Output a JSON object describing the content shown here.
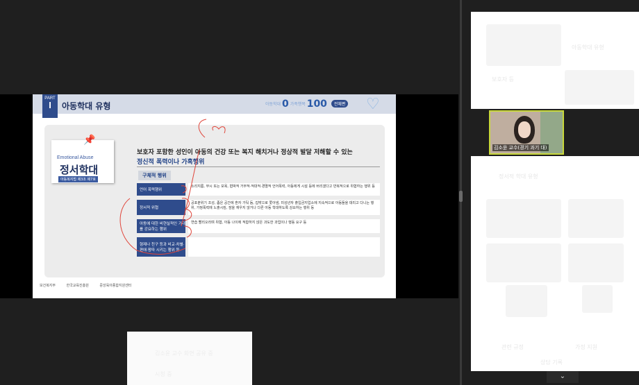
{
  "slide": {
    "part_label": "PART",
    "part_number": "I",
    "title": "아동학대 유형",
    "score_label_left": "아동학대",
    "score_zero": "0",
    "score_label_right": "가족행복",
    "score_hundred": "100",
    "score_pill": "전체편",
    "sticky": {
      "english": "Emotional Abuse",
      "korean": "정서학대",
      "law": "아동복지법 제3조 제7호"
    },
    "definition_line1": "보호자 포함한 성인이 아동의 건강 또는 복지 해치거나 정상적 발달 저해할 수 있는",
    "definition_line2": "정신적 폭력이나 가혹행위",
    "section_heading": "구체적 행위",
    "rows": [
      {
        "label": "언어 폭력행위",
        "desc": "소리지름, 무시 또는 모욕, 협박적 거부적·적대적·경멸적 언어폭력, 아동에게 시설 등에 버리겠다고 반복적으로 위협하는 행위 등"
      },
      {
        "label": "정서적 위협",
        "desc": "공포분위기 조성, 좁은 공간에 혼자 가둬 둠, 집밖으로 쫓아냄, 미성년자 출입금지업소에 지속적으로 아동들을 데리고 다니는 행위, 가정폭력에 노출시킴, 잠을 재우지 않거나 다른 아동 학대하도록 강요하는 행위 등"
      },
      {
        "label": "아동에 대한 비현실적인 기대를 강요하는 행위",
        "desc": "연습 빨리오라며 위협, 아동 나이에 적합하지 않은 과도한 과업이나 행동 요구 등"
      },
      {
        "label": "형제나 친구 등과 비교·차별·편애·왕따 시키는 행위 등",
        "desc": ""
      }
    ],
    "footer": [
      "보건복지부",
      "한국교육진흥원",
      "중앙육아종합지원센터"
    ]
  },
  "speaker": {
    "name": "김소윤 교수(경기 과기 대)"
  },
  "faded_panel": {
    "lines": [
      "아동학대 유형",
      "보호자 등",
      "정서적 학대 유형",
      "관련 규정",
      "가정 지원",
      "상담 기록"
    ]
  },
  "toast": {
    "line1": "김소윤 교수 화면 공유 중",
    "line2": "시청 중"
  },
  "chevron": "⌄"
}
